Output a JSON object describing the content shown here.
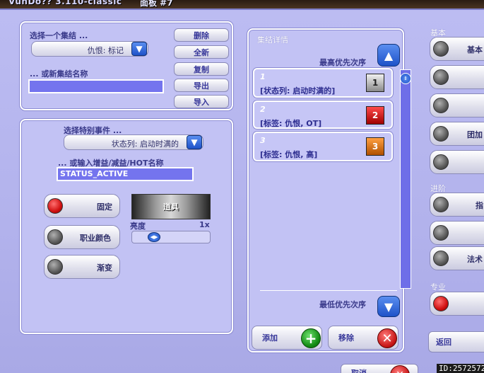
{
  "app": {
    "title": "VuhDo?? 3.110-classic",
    "panel": "面板 #7"
  },
  "set_panel": {
    "select_label": "选择一个集结 ...",
    "selected": "仇恨: 标记",
    "new_label": "... 或新集结名称",
    "new_value": "",
    "buttons": {
      "delete": "删除",
      "new": "全新",
      "copy": "复制",
      "export": "导出",
      "import": "导入"
    }
  },
  "special_panel": {
    "event_label": "选择特别事件 ...",
    "event_selected": "状态列: 启动时满的",
    "buff_label": "... 或输入增益/减益/HOT名称",
    "buff_value": "STATUS_ACTIVE",
    "toggles": {
      "fixed": "固定",
      "class_color": "职业颜色",
      "gradient": "渐变"
    },
    "texture_label": "道具",
    "brightness_label": "亮度",
    "brightness_value": "1x"
  },
  "details_panel": {
    "title": "集结详情",
    "highest": "最高优先次序",
    "lowest": "最低优先次序",
    "items": [
      {
        "num": "1",
        "desc": "[状态列: 启动时满的]",
        "badge": "1",
        "color": "#e8e8e8"
      },
      {
        "num": "2",
        "desc": "[标签: 仇恨, OT]",
        "badge": "2",
        "color": "#c81010"
      },
      {
        "num": "3",
        "desc": "[标签: 仇恨, 高]",
        "badge": "3",
        "color": "#e07818"
      }
    ],
    "add": "添加",
    "remove": "移除"
  },
  "right_panel": {
    "basic": "基本",
    "advanced": "进阶",
    "expert": "专业",
    "items": [
      "基本",
      "",
      "",
      "团加",
      "",
      "指",
      "",
      "法术",
      "",
      ""
    ],
    "back": "返回",
    "cancel": "取消"
  },
  "watermark": "ID:2572572"
}
